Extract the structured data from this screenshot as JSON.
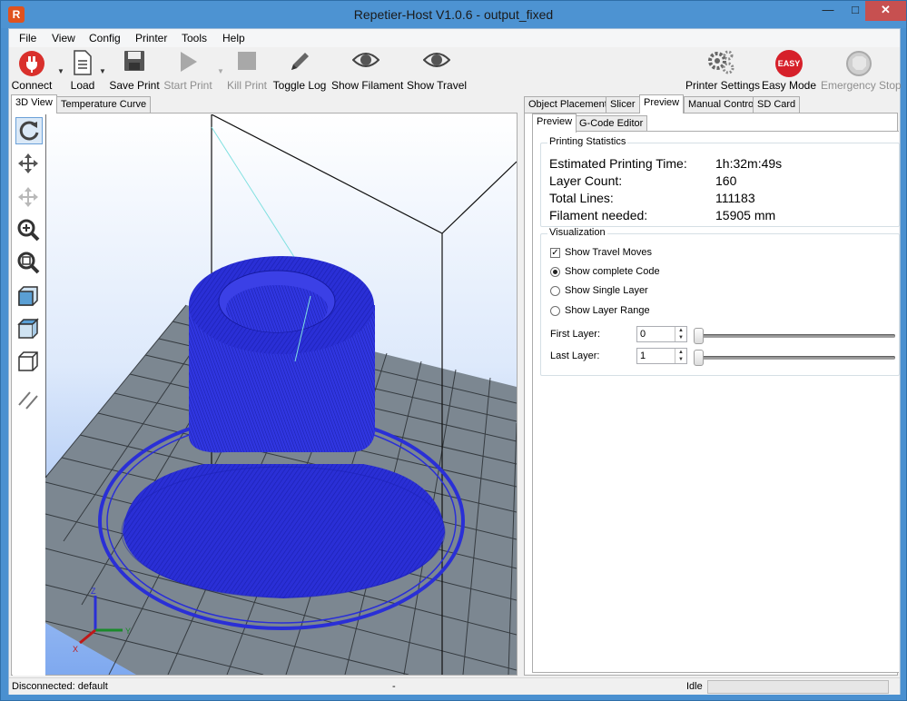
{
  "window": {
    "title": "Repetier-Host V1.0.6 - output_fixed",
    "app_icon": "R",
    "min_glyph": "—",
    "max_glyph": "□",
    "close_glyph": "✕"
  },
  "menu": [
    "File",
    "View",
    "Config",
    "Printer",
    "Tools",
    "Help"
  ],
  "toolbar": {
    "connect": "Connect",
    "load": "Load",
    "save_print": "Save Print",
    "start_print": "Start Print",
    "kill_print": "Kill Print",
    "toggle_log": "Toggle Log",
    "show_filament": "Show Filament",
    "show_travel": "Show Travel",
    "printer_settings": "Printer Settings",
    "easy_mode": "Easy Mode",
    "easy_badge": "EASY",
    "emergency_stop": "Emergency Stop"
  },
  "left_tabs": [
    "3D View",
    "Temperature Curve"
  ],
  "right_tabs": [
    "Object Placement",
    "Slicer",
    "Preview",
    "Manual Control",
    "SD Card"
  ],
  "preview_subtabs": [
    "Preview",
    "G-Code Editor"
  ],
  "printing_statistics": {
    "title": "Printing Statistics",
    "rows": [
      {
        "label": "Estimated Printing Time:",
        "value": "1h:32m:49s"
      },
      {
        "label": "Layer Count:",
        "value": "160"
      },
      {
        "label": "Total Lines:",
        "value": "111183"
      },
      {
        "label": "Filament needed:",
        "value": "15905 mm"
      }
    ]
  },
  "visualization": {
    "title": "Visualization",
    "show_travel_moves": {
      "label": "Show Travel Moves",
      "checked": true
    },
    "show_complete_code": {
      "label": "Show complete Code",
      "selected": true
    },
    "show_single_layer": {
      "label": "Show Single Layer",
      "selected": false
    },
    "show_layer_range": {
      "label": "Show Layer Range",
      "selected": false
    },
    "first_layer": {
      "label": "First Layer:",
      "value": "0"
    },
    "last_layer": {
      "label": "Last Layer:",
      "value": "1"
    }
  },
  "status": {
    "connection": "Disconnected: default",
    "center": "-",
    "state": "Idle",
    "progress": 0
  },
  "axes": {
    "x": "X",
    "y": "Y",
    "z": "Z"
  },
  "colors": {
    "model": "#2a2fd6",
    "bed": "#7f8a92",
    "accent": "#4d93d2",
    "easy_badge": "#d6202a",
    "connect_icon": "#d9302c"
  }
}
